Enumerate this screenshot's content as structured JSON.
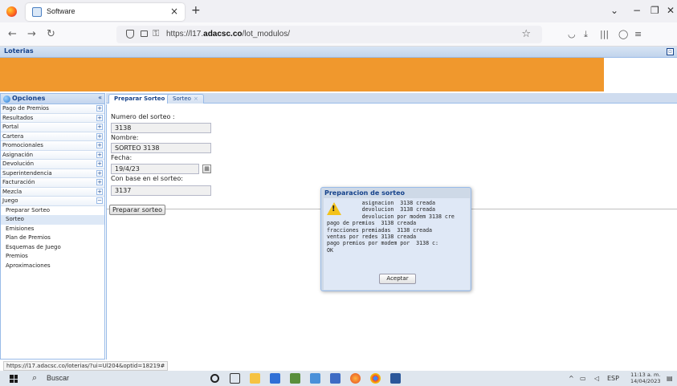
{
  "browser": {
    "tab_title": "Software",
    "tab_close": "×",
    "new_tab": "+",
    "url_prefix": "https://l17.",
    "url_domain": "adacsc.co",
    "url_path": "/lot_modulos/",
    "status_url": "https://l17.adacsc.co/loterias/?ui=Ul204&optid=18219#"
  },
  "app": {
    "title": "Loterias"
  },
  "sidebar": {
    "title": "Opciones",
    "collapse": "«",
    "items": [
      {
        "label": "Pago de Premios",
        "toggle": "+"
      },
      {
        "label": "Resultados",
        "toggle": "+"
      },
      {
        "label": "Portal",
        "toggle": "+"
      },
      {
        "label": "Cartera",
        "toggle": "+"
      },
      {
        "label": "Promocionales",
        "toggle": "+"
      },
      {
        "label": "Asignación",
        "toggle": "+"
      },
      {
        "label": "Devolución",
        "toggle": "+"
      },
      {
        "label": "Superintendencia",
        "toggle": "+"
      },
      {
        "label": "Facturación",
        "toggle": "+"
      },
      {
        "label": "Mezcla",
        "toggle": "+"
      },
      {
        "label": "Juego",
        "toggle": "−"
      }
    ],
    "subitems": [
      "Preparar Sorteo",
      "Sorteo",
      "Emisiones",
      "Plan de Premios",
      "Esquemas de Juego",
      "Premios",
      "Aproximaciones"
    ],
    "selected_subitem": "Sorteo"
  },
  "tabs": [
    {
      "label": "Preparar Sorteo",
      "close": "×",
      "active": true
    },
    {
      "label": "Sorteo",
      "close": "×",
      "active": false
    }
  ],
  "form": {
    "numero_label": "Numero del sorteo :",
    "numero_value": "3138",
    "nombre_label": "Nombre:",
    "nombre_value": "SORTEO 3138",
    "fecha_label": "Fecha:",
    "fecha_value": "19/4/23",
    "base_label": "Con base en el sorteo:",
    "base_value": "3137",
    "submit_label": "Preparar sorteo"
  },
  "dialog": {
    "title": "Preparacion de sorteo",
    "message": "           asignacion  3138 creada\n           devolucion  3138 creada\n           devolucion por modem 3138 cre\npago de premios  3138 creada\nfracciones premiadas  3138 creada\nventas por redes 3138 creada\npago premios por modem por  3138 c:\nOK",
    "button": "Aceptar"
  },
  "taskbar": {
    "search_text": "Buscar",
    "lang": "ESP",
    "time": "11:13 a. m.",
    "date": "14/04/2023"
  },
  "colors": {
    "banner": "#f0982d",
    "ext_blue": "#15428b"
  }
}
